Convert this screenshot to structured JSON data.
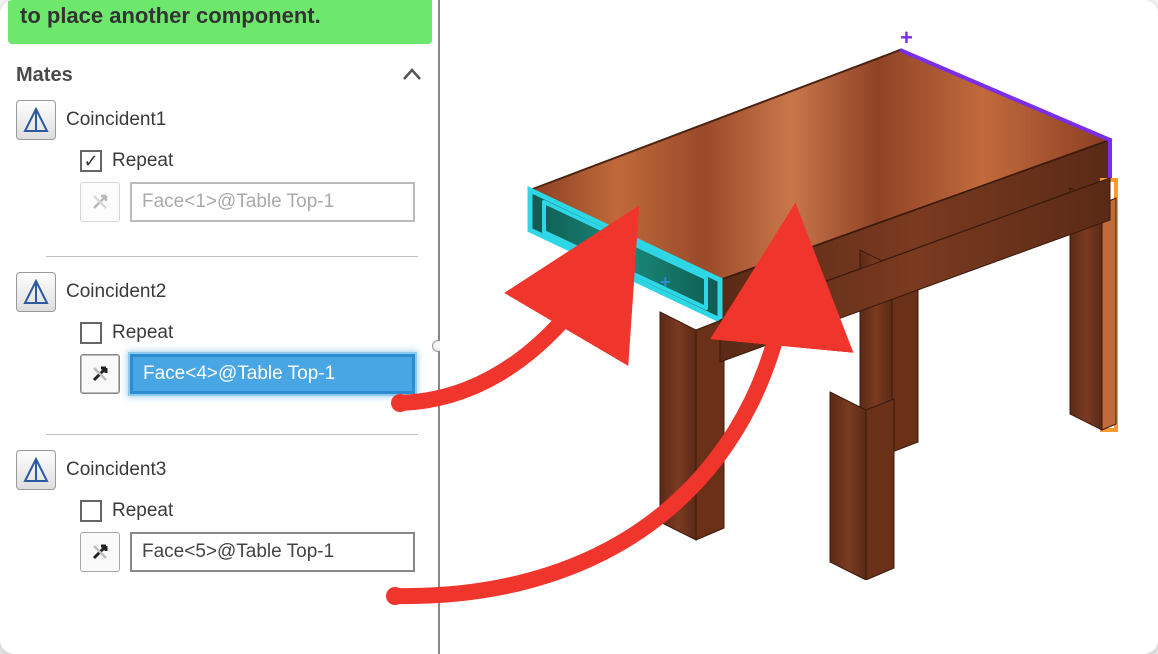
{
  "hint": "to place another component.",
  "mates_header": "Mates",
  "mates": [
    {
      "name": "Coincident1",
      "repeat_checked": true,
      "repeat_label": "Repeat",
      "face": "Face<1>@Table Top-1",
      "face_state": "ghost"
    },
    {
      "name": "Coincident2",
      "repeat_checked": false,
      "repeat_label": "Repeat",
      "face": "Face<4>@Table Top-1",
      "face_state": "selected"
    },
    {
      "name": "Coincident3",
      "repeat_checked": false,
      "repeat_label": "Repeat",
      "face": "Face<5>@Table Top-1",
      "face_state": "normal"
    }
  ],
  "colors": {
    "hint_bg": "#6de86d",
    "sel_blue": "#49a6e4",
    "arrow": "#f0352d",
    "wood1": "#9a4a2a",
    "wood2": "#c26a3c",
    "front_face": "#167a6c",
    "front_edge": "#2fd7e6",
    "right_edge": "#ff9a2e",
    "top_edge": "#7a2ee8"
  }
}
